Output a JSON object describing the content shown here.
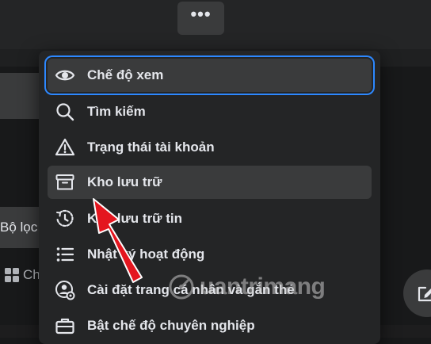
{
  "background": {
    "filter_label": "Bộ lọc",
    "grid_label": "Chế độ xem lưới"
  },
  "more_button": {
    "label": "•••"
  },
  "menu": {
    "items": [
      {
        "label": "Chế độ xem",
        "icon": "eye-icon",
        "state": "focused"
      },
      {
        "label": "Tìm kiếm",
        "icon": "search-icon"
      },
      {
        "label": "Trạng thái tài khoản",
        "icon": "warning-icon"
      },
      {
        "label": "Kho lưu trữ",
        "icon": "archive-box-icon",
        "state": "hovered"
      },
      {
        "label": "Kho lưu trữ tin",
        "icon": "clock-history-icon"
      },
      {
        "label": "Nhật ký hoạt động",
        "icon": "list-icon"
      },
      {
        "label": "Cài đặt trang cá nhân và gắn thẻ",
        "icon": "profile-settings-icon"
      },
      {
        "label": "Bật chế độ chuyên nghiệp",
        "icon": "briefcase-icon"
      }
    ]
  },
  "watermark": {
    "text": "uantrimang"
  },
  "colors": {
    "page_bg": "#18191a",
    "surface": "#242526",
    "hover": "#3a3b3c",
    "text": "#e4e6eb",
    "focus_ring": "#2d88ff",
    "annotation_arrow": "#e4161f"
  }
}
